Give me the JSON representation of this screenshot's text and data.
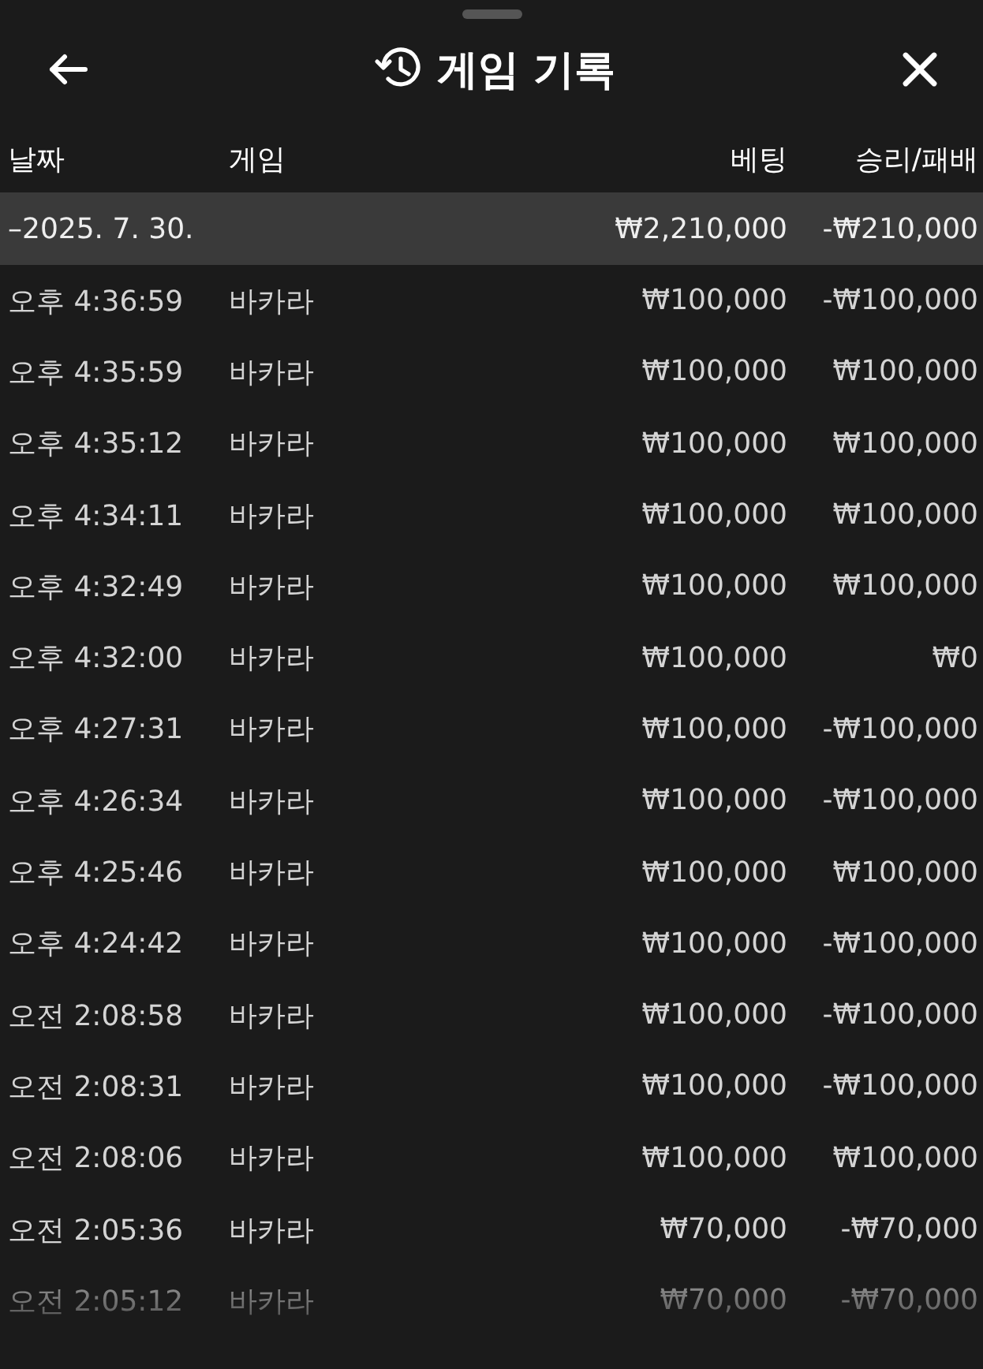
{
  "header": {
    "title": "게임 기록"
  },
  "table": {
    "columns": [
      "날짜",
      "게임",
      "베팅",
      "승리/패배"
    ],
    "group": {
      "date": "–2025. 7. 30.",
      "bet": "₩2,210,000",
      "result": "-₩210,000"
    },
    "rows": [
      {
        "time": "오후 4:36:59",
        "game": "바카라",
        "bet": "₩100,000",
        "result": "-₩100,000"
      },
      {
        "time": "오후 4:35:59",
        "game": "바카라",
        "bet": "₩100,000",
        "result": "₩100,000"
      },
      {
        "time": "오후 4:35:12",
        "game": "바카라",
        "bet": "₩100,000",
        "result": "₩100,000"
      },
      {
        "time": "오후 4:34:11",
        "game": "바카라",
        "bet": "₩100,000",
        "result": "₩100,000"
      },
      {
        "time": "오후 4:32:49",
        "game": "바카라",
        "bet": "₩100,000",
        "result": "₩100,000"
      },
      {
        "time": "오후 4:32:00",
        "game": "바카라",
        "bet": "₩100,000",
        "result": "₩0"
      },
      {
        "time": "오후 4:27:31",
        "game": "바카라",
        "bet": "₩100,000",
        "result": "-₩100,000"
      },
      {
        "time": "오후 4:26:34",
        "game": "바카라",
        "bet": "₩100,000",
        "result": "-₩100,000"
      },
      {
        "time": "오후 4:25:46",
        "game": "바카라",
        "bet": "₩100,000",
        "result": "₩100,000"
      },
      {
        "time": "오후 4:24:42",
        "game": "바카라",
        "bet": "₩100,000",
        "result": "-₩100,000"
      },
      {
        "time": "오전 2:08:58",
        "game": "바카라",
        "bet": "₩100,000",
        "result": "-₩100,000"
      },
      {
        "time": "오전 2:08:31",
        "game": "바카라",
        "bet": "₩100,000",
        "result": "-₩100,000"
      },
      {
        "time": "오전 2:08:06",
        "game": "바카라",
        "bet": "₩100,000",
        "result": "₩100,000"
      },
      {
        "time": "오전 2:05:36",
        "game": "바카라",
        "bet": "₩70,000",
        "result": "-₩70,000"
      },
      {
        "time": "오전 2:05:12",
        "game": "바카라",
        "bet": "₩70,000",
        "result": "-₩70,000"
      }
    ]
  }
}
